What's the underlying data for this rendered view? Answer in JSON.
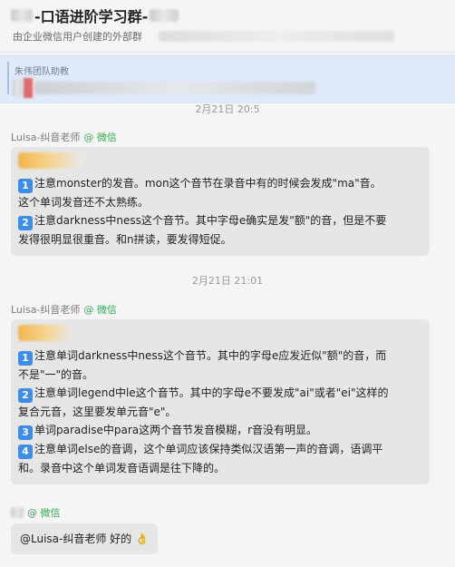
{
  "header": {
    "title": "-口语进阶学习群-",
    "subtitle": "由企业微信用户创建的外部群"
  },
  "pinned": {
    "title": "朱伟团队助教"
  },
  "messages": [
    {
      "timestamp": "2月21日 20:5",
      "sender": "Luisa-纠音老师",
      "sender_tag": "@ 微信",
      "lines": [
        {
          "num": "1",
          "text": "注意monster的发音。mon这个音节在录音中有的时候会发成\"ma\"音。"
        },
        {
          "num": "",
          "text": "这个单词发音还不太熟练。"
        },
        {
          "num": "2",
          "text": "注意darkness中ness这个音节。其中字母e确实是发\"额\"的音，但是不要"
        },
        {
          "num": "",
          "text": "发得很明显很重音。和n拼读，要发得短促。"
        }
      ]
    },
    {
      "timestamp": "2月21日 21:01",
      "sender": "Luisa-纠音老师",
      "sender_tag": "@ 微信",
      "lines": [
        {
          "num": "1",
          "text": "注意单词darkness中ness这个音节。其中的字母e应发近似\"额\"的音，而"
        },
        {
          "num": "",
          "text": "不是\"一\"的音。"
        },
        {
          "num": "2",
          "text": "注意单词legend中le这个音节。其中的字母e不要发成\"ai\"或者\"ei\"这样的"
        },
        {
          "num": "",
          "text": "复合元音，这里要发单元音\"e\"。"
        },
        {
          "num": "3",
          "text": "单词paradise中para这两个音节发音模糊，r音没有明显。"
        },
        {
          "num": "4",
          "text": "注意单词else的音调，这个单词应该保持类似汉语第一声的音调，语调平"
        },
        {
          "num": "",
          "text": "和。录音中这个单词发音语调是往下降的。"
        }
      ]
    }
  ],
  "reply": {
    "sender_tag": "@ 微信",
    "text": "@Luisa-纠音老师 好的",
    "emoji": "👌"
  }
}
